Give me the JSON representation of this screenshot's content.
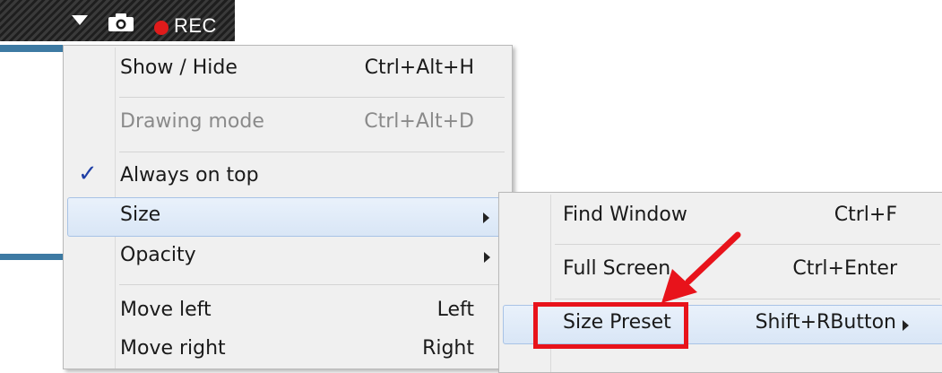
{
  "toolbar": {
    "rec_label": "REC",
    "icons": [
      "dropdown-icon",
      "camera-icon",
      "record-dot-icon"
    ]
  },
  "main_menu": {
    "items": [
      {
        "label": "Show / Hide",
        "shortcut": "Ctrl+Alt+H"
      },
      {
        "label": "Drawing mode",
        "shortcut": "Ctrl+Alt+D",
        "disabled": true
      },
      {
        "label": "Always on top",
        "checked": true
      },
      {
        "label": "Size",
        "submenu": true,
        "highlighted": true
      },
      {
        "label": "Opacity",
        "submenu": true
      },
      {
        "label": "Move left",
        "shortcut": "Left"
      },
      {
        "label": "Move right",
        "shortcut": "Right"
      }
    ]
  },
  "size_submenu": {
    "items": [
      {
        "label": "Find Window",
        "shortcut": "Ctrl+F"
      },
      {
        "label": "Full Screen",
        "shortcut": "Ctrl+Enter"
      },
      {
        "label": "Size Preset",
        "shortcut": "Shift+RButton",
        "submenu": true,
        "highlighted": true
      }
    ]
  },
  "colors": {
    "highlight_border": "#a8c3e6",
    "annotation_red": "#e8131b",
    "rec_red": "#e01b1b",
    "check_blue": "#1f3fa6"
  }
}
